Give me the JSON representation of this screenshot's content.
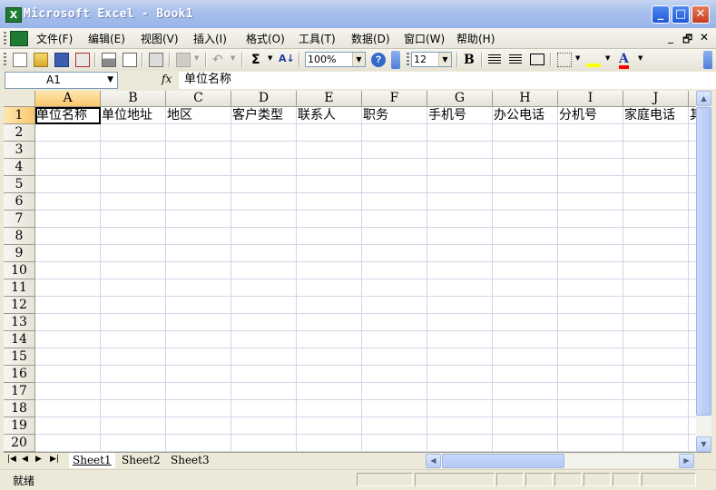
{
  "window": {
    "title": "Microsoft Excel - Book1",
    "app_icon_glyph": "X",
    "controls": {
      "minimize": "_",
      "maximize": "□",
      "close": "✕"
    }
  },
  "menubar": {
    "items": [
      "文件(F)",
      "编辑(E)",
      "视图(V)",
      "插入(I)",
      "格式(O)",
      "工具(T)",
      "数据(D)",
      "窗口(W)",
      "帮助(H)"
    ],
    "doc_controls": {
      "minimize": "_",
      "restore": "🗗",
      "close": "✕"
    }
  },
  "toolbar": {
    "zoom": "100%",
    "font_size": "12",
    "sum_symbol": "Σ",
    "bold_label": "B",
    "font_color_label": "A",
    "sort_label": "A↓",
    "icons": [
      "new-icon",
      "open-icon",
      "save-icon",
      "permission-icon",
      "print-icon",
      "print-preview-icon",
      "research-icon",
      "paste-icon",
      "undo-icon",
      "autosum-icon",
      "sort-ascending-icon",
      "help-icon",
      "bold-icon",
      "align-left-icon",
      "center-icon",
      "merge-center-icon",
      "borders-icon",
      "fill-color-icon",
      "font-color-icon"
    ],
    "colors": {
      "fill": "#ffff00",
      "font": "#ff0000"
    }
  },
  "formula_bar": {
    "name_box": "A1",
    "fx_label": "fx",
    "formula": "单位名称"
  },
  "grid": {
    "columns": [
      "A",
      "B",
      "C",
      "D",
      "E",
      "F",
      "G",
      "H",
      "I",
      "J"
    ],
    "rows": [
      "1",
      "2",
      "3",
      "4",
      "5",
      "6",
      "7",
      "8",
      "9",
      "10",
      "11",
      "12",
      "13",
      "14",
      "15",
      "16",
      "17",
      "18",
      "19",
      "20"
    ],
    "row1": [
      "单位名称",
      "单位地址",
      "地区",
      "客户类型",
      "联系人",
      "职务",
      "手机号",
      "办公电话",
      "分机号",
      "家庭电话",
      "其"
    ],
    "active_cell": "A1"
  },
  "sheets": {
    "nav": [
      "|◀",
      "◀",
      "▶",
      "▶|"
    ],
    "tabs": [
      "Sheet1",
      "Sheet2",
      "Sheet3"
    ],
    "active": "Sheet1"
  },
  "status": {
    "text": "就绪"
  }
}
